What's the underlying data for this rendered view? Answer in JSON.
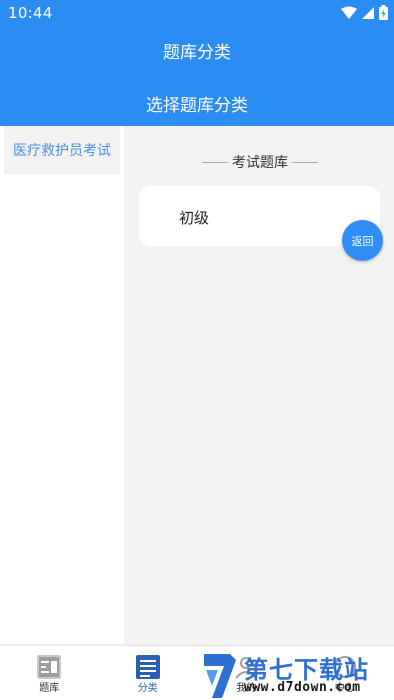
{
  "status_bar": {
    "time": "10:44"
  },
  "header": {
    "title": "题库分类",
    "subtitle": "选择题库分类"
  },
  "sidebar": {
    "items": [
      {
        "label": "医疗救护员考试"
      }
    ]
  },
  "main": {
    "section_title": "考试题库",
    "cards": [
      {
        "label": "初级"
      }
    ]
  },
  "back_button": {
    "label": "返回"
  },
  "bottom_nav": {
    "items": [
      {
        "label": "题库",
        "icon": "question-bank-icon"
      },
      {
        "label": "分类",
        "icon": "category-icon",
        "active": true
      },
      {
        "label": "我的",
        "icon": "profile-icon"
      },
      {
        "label": "中心",
        "icon": "center-icon"
      }
    ]
  },
  "watermark": {
    "title": "第七下载站",
    "url": "www.d7down.com"
  },
  "colors": {
    "primary": "#2b8df3",
    "accent": "#2f8ff5",
    "sidebar_text": "#4a90e2"
  }
}
